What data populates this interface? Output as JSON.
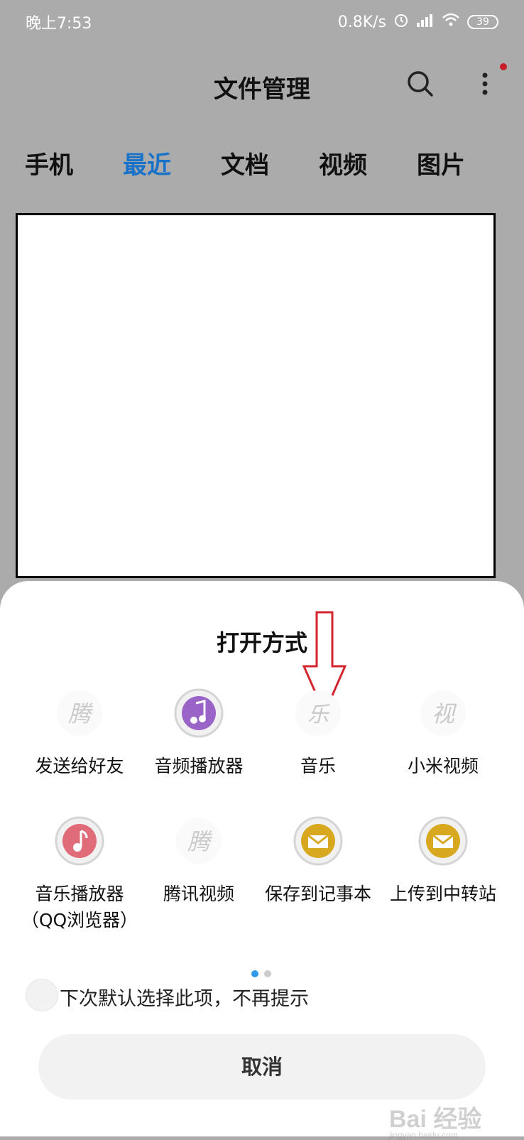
{
  "status_bar": {
    "time": "晚上7:53",
    "speed": "0.8K/s",
    "battery": "39"
  },
  "app_bar": {
    "title": "文件管理"
  },
  "tabs": [
    {
      "label": "手机"
    },
    {
      "label": "最近",
      "active": true
    },
    {
      "label": "文档"
    },
    {
      "label": "视频"
    },
    {
      "label": "图片"
    }
  ],
  "sheet": {
    "title": "打开方式",
    "apps": [
      {
        "label": "发送给好友",
        "icon": "tencent-icon"
      },
      {
        "label": "音频播放器",
        "icon": "audio-player-icon"
      },
      {
        "label": "音乐",
        "icon": "music-icon"
      },
      {
        "label": "小米视频",
        "icon": "mi-video-icon"
      },
      {
        "label": "音乐播放器\n（QQ浏览器）",
        "icon": "music-player-icon"
      },
      {
        "label": "腾讯视频",
        "icon": "tencent-video-icon"
      },
      {
        "label": "保存到记事本",
        "icon": "notepad-icon"
      },
      {
        "label": "上传到中转站",
        "icon": "upload-icon"
      }
    ],
    "page_indicator": {
      "current": 1,
      "total": 2
    },
    "default_label": "下次默认选择此项，不再提示",
    "cancel_label": "取消"
  },
  "watermark": {
    "brand": "Bai 经验",
    "url": "jingyan.baidu.com"
  },
  "colors": {
    "accent": "#1872c9",
    "overlay_bg": "#ababab",
    "arrow_red": "#d3262e",
    "dot_active": "#2f9be8",
    "dot_inactive": "#cccccc"
  }
}
